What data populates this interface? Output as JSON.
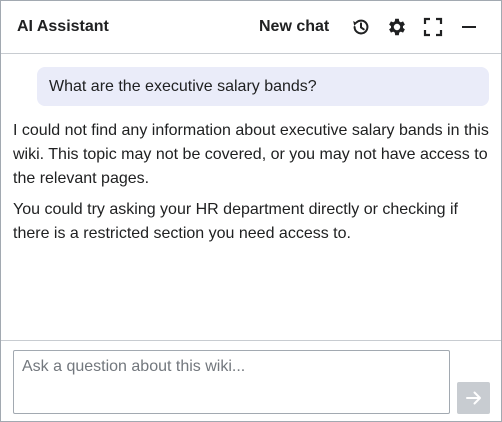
{
  "header": {
    "title": "AI Assistant",
    "new_chat_label": "New chat",
    "icons": [
      "history-icon",
      "gear-icon",
      "fullscreen-icon",
      "minimize-icon"
    ]
  },
  "conversation": {
    "user_message": "What are the executive salary bands?",
    "assistant_paragraphs": [
      "I could not find any information about executive salary bands in this wiki. This topic may not be covered, or you may not have access to the relevant pages.",
      "You could try asking your HR department directly or checking if there is a restricted section you need access to."
    ]
  },
  "composer": {
    "placeholder": "Ask a question about this wiki...",
    "value": "",
    "send_icon": "arrow-right-icon"
  },
  "colors": {
    "user_bubble": "#eaecf9",
    "border": "#c8ccd1",
    "send_disabled": "#c8ccd1",
    "text": "#202122"
  }
}
